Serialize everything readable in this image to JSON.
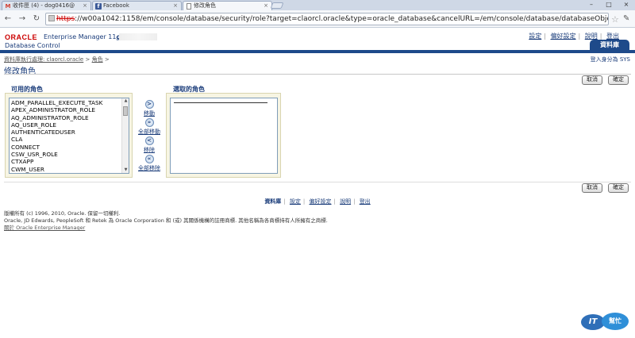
{
  "browser": {
    "tabs": [
      {
        "icon": "gmail-icon",
        "label": "收件匣 (4) - dog0416@"
      },
      {
        "icon": "facebook-icon",
        "label": "Facebook"
      },
      {
        "icon": "document-icon",
        "label": "修改角色"
      }
    ],
    "url_scheme": "https",
    "url_rest": "://w00a1042:1158/em/console/database/security/role?target=claorcl.oracle&type=oracle_database&cancelURL=/em/console/database/databaseObjec"
  },
  "header": {
    "logo": "ORACLE",
    "product": "Enterprise Manager 11",
    "product_suffix": "g",
    "subtitle": "Database Control",
    "links": [
      "設定",
      "偏好設定",
      "說明",
      "登出"
    ],
    "active_tab": "資料庫"
  },
  "breadcrumb": {
    "items": [
      "資料庫執行處理: claorcl.oracle",
      "角色"
    ],
    "separator": ">",
    "login_as": "登入身分為 SYS"
  },
  "page_title": "修改角色",
  "buttons": {
    "cancel": "取消",
    "ok": "確定"
  },
  "shuttle": {
    "available_label": "可用的角色",
    "selected_label": "選取的角色",
    "available_items": [
      "ADM_PARALLEL_EXECUTE_TASK",
      "APEX_ADMINISTRATOR_ROLE",
      "AQ_ADMINISTRATOR_ROLE",
      "AQ_USER_ROLE",
      "AUTHENTICATEDUSER",
      "CLA",
      "CONNECT",
      "CSW_USR_ROLE",
      "CTXAPP",
      "CWM_USER"
    ],
    "controls": {
      "move": "移動",
      "move_all": "全部移動",
      "remove": "移除",
      "remove_all": "全部移除"
    }
  },
  "footer": {
    "links": [
      "資料庫",
      "設定",
      "偏好設定",
      "說明",
      "登出"
    ],
    "copyright_line1": "版權所有 (c) 1996, 2010, Oracle. 保留一切權利.",
    "copyright_line2": "Oracle, JD Edwards, PeopleSoft 和 Retek 為 Oracle Corporation 和 (或) 其關係機構的註冊商標. 其他名稱為各商標持有人所擁有之商標.",
    "about": "關於 Oracle Enterprise Manager"
  },
  "watermark": {
    "part1": "IT",
    "part2": "幫忙"
  }
}
